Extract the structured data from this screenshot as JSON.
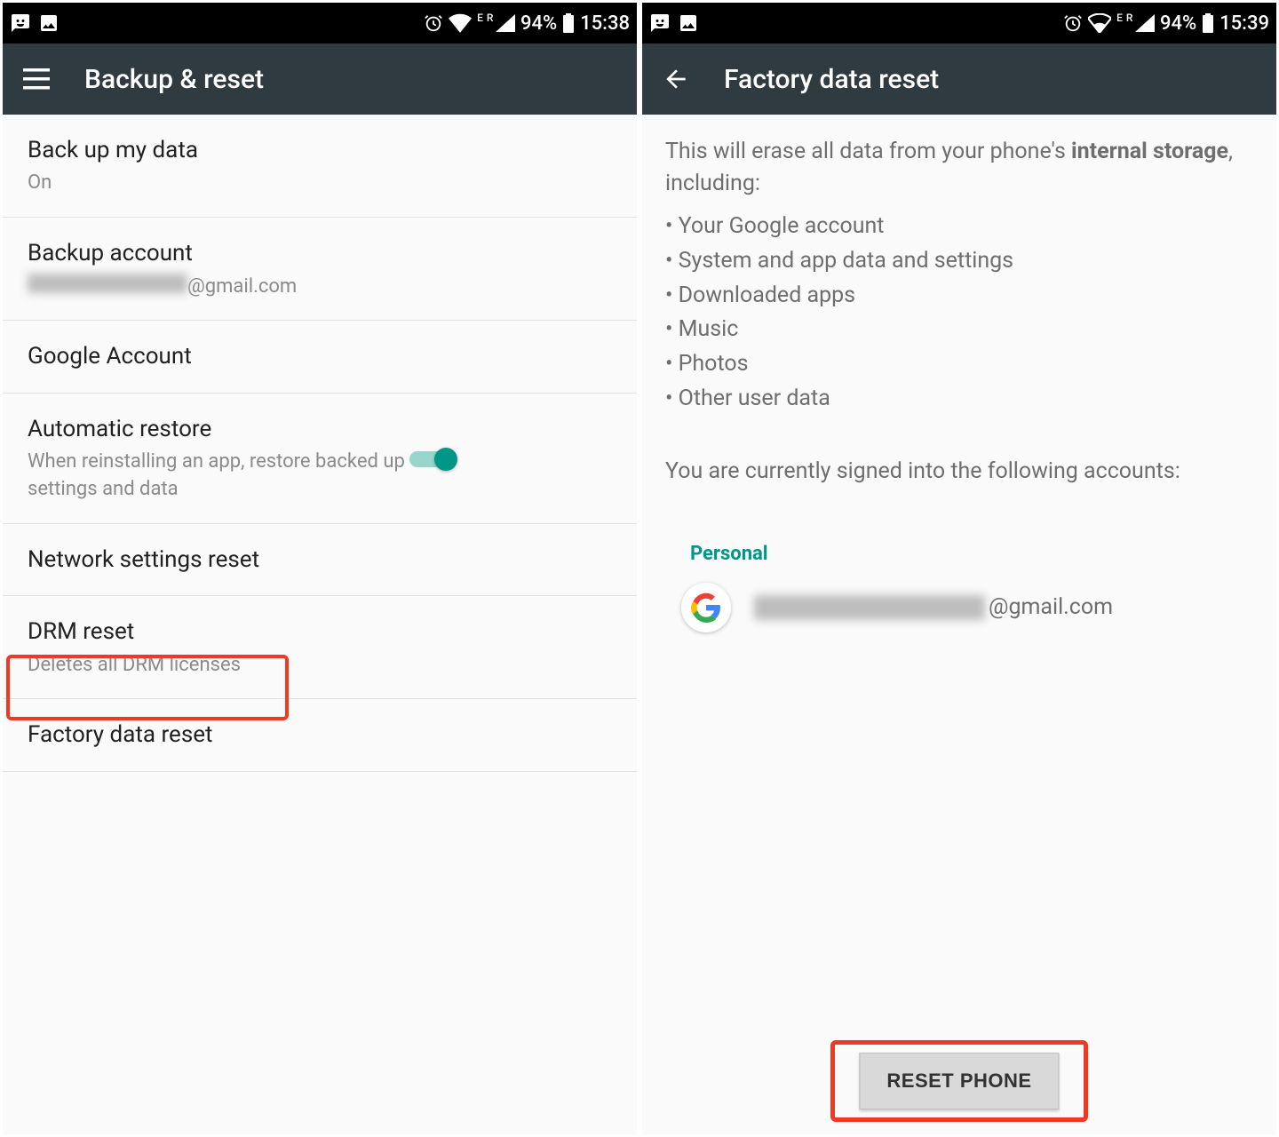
{
  "left": {
    "status": {
      "battery": "94%",
      "time": "15:38",
      "network_label": "E R"
    },
    "appbar": {
      "title": "Backup & reset"
    },
    "items": {
      "backup_data": {
        "title": "Back up my data",
        "sub": "On"
      },
      "backup_account": {
        "title": "Backup account",
        "suffix": "@gmail.com"
      },
      "google_account": {
        "title": "Google Account"
      },
      "auto_restore": {
        "title": "Automatic restore",
        "sub": "When reinstalling an app, restore backed up settings and data"
      },
      "network_reset": {
        "title": "Network settings reset"
      },
      "drm_reset": {
        "title": "DRM reset",
        "sub": "Deletes all DRM licenses"
      },
      "factory_reset": {
        "title": "Factory data reset"
      }
    }
  },
  "right": {
    "status": {
      "battery": "94%",
      "time": "15:39",
      "network_label": "E R"
    },
    "appbar": {
      "title": "Factory data reset"
    },
    "intro_prefix": "This will erase all data from your phone's ",
    "intro_bold": "internal storage",
    "intro_suffix": ", including:",
    "bullets": [
      "Your Google account",
      "System and app data and settings",
      "Downloaded apps",
      "Music",
      "Photos",
      "Other user data"
    ],
    "signed_text": "You are currently signed into the following accounts:",
    "personal_label": "Personal",
    "account_suffix": "@gmail.com",
    "reset_button": "RESET PHONE"
  }
}
